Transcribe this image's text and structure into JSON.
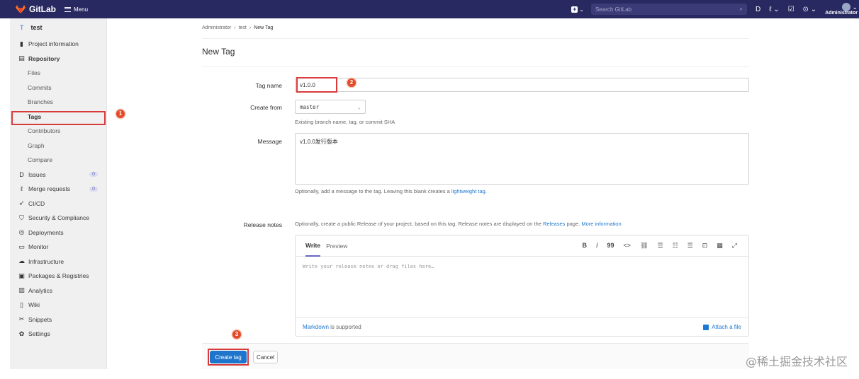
{
  "navbar": {
    "brand": "GitLab",
    "menu_label": "Menu",
    "search_placeholder": "Search GitLab",
    "user_label": "Administrator"
  },
  "sidebar": {
    "project_initial": "T",
    "project_name": "test",
    "project_information": "Project information",
    "repository": "Repository",
    "repo_items": [
      "Files",
      "Commits",
      "Branches",
      "Tags",
      "Contributors",
      "Graph",
      "Compare"
    ],
    "issues": "Issues",
    "issues_count": "0",
    "merge_requests": "Merge requests",
    "merge_requests_count": "0",
    "cicd": "CI/CD",
    "security": "Security & Compliance",
    "deployments": "Deployments",
    "monitor": "Monitor",
    "infrastructure": "Infrastructure",
    "packages": "Packages & Registries",
    "analytics": "Analytics",
    "wiki": "Wiki",
    "snippets": "Snippets",
    "settings": "Settings"
  },
  "breadcrumb": [
    "Administrator",
    "test",
    "New Tag"
  ],
  "page_title": "New Tag",
  "form": {
    "tag_name_label": "Tag name",
    "tag_name_value": "v1.0.0",
    "create_from_label": "Create from",
    "create_from_value": "master",
    "create_from_help": "Existing branch name, tag, or commit SHA",
    "message_label": "Message",
    "message_value": "v1.0.0发行版本",
    "message_help": "Optionally, add a message to the tag. Leaving this blank creates a",
    "message_help_link": "lightweight tag.",
    "release_notes_label": "Release notes",
    "release_help_1": "Optionally, create a public Release of your project, based on this tag. Release notes are displayed on the",
    "release_help_link1": "Releases",
    "release_help_2": "page.",
    "release_help_link2": "More information"
  },
  "editor": {
    "tab_write": "Write",
    "tab_preview": "Preview",
    "toolbar": [
      "B",
      "I",
      "99",
      "<>",
      "⛓",
      "☰",
      "☷",
      "☰",
      "⊡",
      "▦",
      "⤢"
    ],
    "placeholder": "Write your release notes or drag files here…",
    "markdown_link": "Markdown",
    "markdown_text": "is supported",
    "attach": "Attach a file"
  },
  "actions": {
    "create": "Create tag",
    "cancel": "Cancel"
  },
  "annotations": {
    "marker_sidebar": "1",
    "marker_tagname": "2",
    "marker_create": "3"
  },
  "watermark": "@稀土掘金技术社区"
}
